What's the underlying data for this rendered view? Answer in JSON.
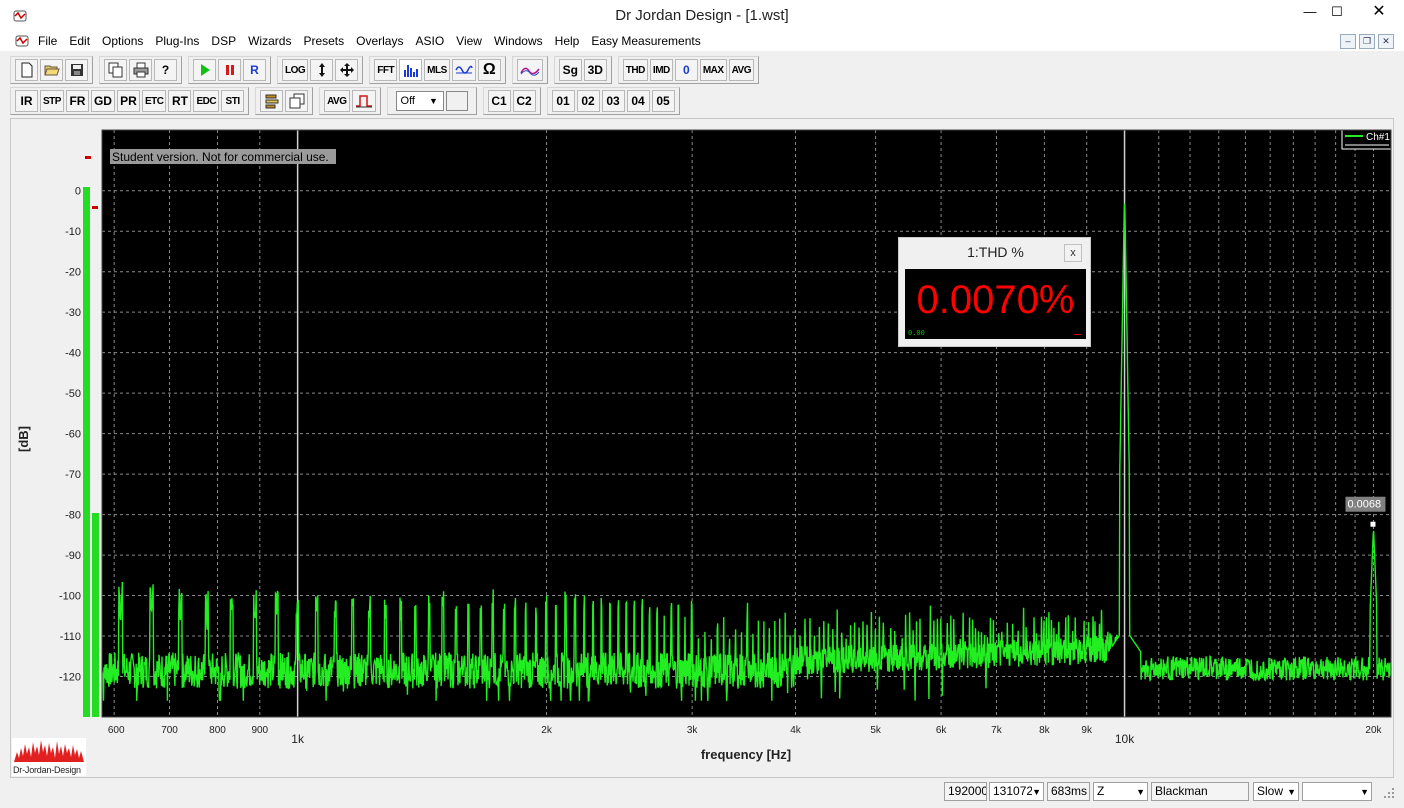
{
  "window": {
    "title": "Dr Jordan Design - [1.wst]",
    "minimize": "—",
    "maximize": "☐",
    "close": "✕"
  },
  "menu": {
    "items": [
      "File",
      "Edit",
      "Options",
      "Plug-Ins",
      "DSP",
      "Wizards",
      "Presets",
      "Overlays",
      "ASIO",
      "View",
      "Windows",
      "Help",
      "Easy Measurements"
    ],
    "mdi_min": "–",
    "mdi_restore": "❐",
    "mdi_close": "✕"
  },
  "toolbar1": {
    "g1": [
      "new-icon",
      "open-icon",
      "save-icon"
    ],
    "g2": [
      "copy-icon",
      "print-icon",
      "help-icon"
    ],
    "g3": [
      "play-icon",
      "pause-icon",
      "R"
    ],
    "r_label": "R",
    "log_label": "LOG",
    "fft_label": "FFT",
    "mls_label": "MLS",
    "sg_label": "Sg",
    "threed_label": "3D",
    "thd_label": "THD",
    "imd_label": "IMD",
    "zero_label": "0",
    "max_label": "MAX",
    "avg_label": "AVG"
  },
  "toolbar2": {
    "analysis": [
      "IR",
      "STP",
      "FR",
      "GD",
      "PR",
      "ETC",
      "RT",
      "EDC",
      "STI"
    ],
    "avg_label": "AVG",
    "off_combo": "Off",
    "channels": [
      "C1",
      "C2"
    ],
    "overlays": [
      "01",
      "02",
      "03",
      "04",
      "05"
    ]
  },
  "graph": {
    "watermark": "Student version. Not for commercial use.",
    "legend_label": "Ch#1",
    "marker_value": "0.0068",
    "ylabel": "[dB]",
    "xlabel": "frequency [Hz]",
    "yticks": [
      "0",
      "-10",
      "-20",
      "-30",
      "-40",
      "-50",
      "-60",
      "-70",
      "-80",
      "-90",
      "-100",
      "-110",
      "-120"
    ],
    "xticks": [
      "600",
      "700",
      "800",
      "900",
      "1k",
      "2k",
      "3k",
      "4k",
      "5k",
      "6k",
      "7k",
      "8k",
      "9k",
      "10k",
      "20k"
    ],
    "background": "#000000",
    "trace_color": "#22ee22",
    "meter_color": "#22dd22"
  },
  "chart_data": {
    "type": "line",
    "title": "",
    "xlabel": "frequency [Hz]",
    "ylabel": "[dB]",
    "xscale": "log",
    "xlim": [
      580,
      21000
    ],
    "ylim": [
      -130,
      15
    ],
    "grid": true,
    "legend": "top-right",
    "series": [
      {
        "name": "Ch#1",
        "x": [
          580,
          600,
          650,
          700,
          750,
          800,
          850,
          900,
          950,
          1000,
          1500,
          2000,
          3000,
          4000,
          5000,
          6000,
          7000,
          8000,
          9000,
          9800,
          10000,
          10200,
          11000,
          12000,
          14000,
          16000,
          18000,
          20000,
          20200,
          21000
        ],
        "y": [
          -118,
          -117,
          -101,
          -119,
          -102,
          -120,
          -99,
          -118,
          -114,
          -117,
          -103,
          -103,
          -103,
          -105,
          -108,
          -110,
          -110,
          -111,
          -112,
          -113,
          0,
          -112,
          -116,
          -117,
          -117,
          -117,
          -118,
          -83,
          -117,
          -118
        ]
      }
    ],
    "annotations": [
      {
        "text": "0.0068",
        "x": 20000,
        "y": -83
      }
    ]
  },
  "thd_window": {
    "title": "1:THD %",
    "close": "x",
    "value": "0.0070%",
    "small_text": "0.00"
  },
  "logo": {
    "text": "Dr-Jordan-Design"
  },
  "statusbar": {
    "sample_rate": "192000",
    "fft_size": "131072",
    "duration": "683ms",
    "weighting": "Z",
    "window": "Blackman",
    "speed": "Slow",
    "extra": ""
  }
}
